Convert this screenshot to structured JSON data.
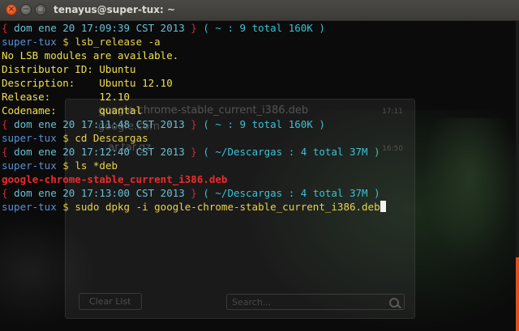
{
  "window": {
    "title": "tenayus@super-tux: ~",
    "close_symbol": "×",
    "minimize_symbol": "−",
    "maximize_symbol": "□"
  },
  "terminal": {
    "host": "super-tux",
    "lines": [
      {
        "type": "status",
        "date": "dom ene 20 17:09:39 CST 2013",
        "dir": "~ : 9 total 160K"
      },
      {
        "type": "prompt",
        "cmd": "lsb_release -a"
      },
      {
        "type": "output",
        "text": "No LSB modules are available."
      },
      {
        "type": "output",
        "text": "Distributor ID: Ubuntu"
      },
      {
        "type": "output",
        "text": "Description:    Ubuntu 12.10"
      },
      {
        "type": "output",
        "text": "Release:        12.10"
      },
      {
        "type": "output",
        "text": "Codename:       quantal"
      },
      {
        "type": "status",
        "date": "dom ene 20 17:11:48 CST 2013",
        "dir": "~ : 9 total 160K"
      },
      {
        "type": "prompt",
        "cmd": "cd Descargas"
      },
      {
        "type": "status",
        "date": "dom ene 20 17:12:40 CST 2013",
        "dir": "~/Descargas : 4 total 37M"
      },
      {
        "type": "prompt",
        "cmd": "ls *deb"
      },
      {
        "type": "file",
        "text": "google-chrome-stable_current_i386.deb"
      },
      {
        "type": "status",
        "date": "dom ene 20 17:13:00 CST 2013",
        "dir": "~/Descargas : 4 total 37M"
      },
      {
        "type": "prompt",
        "cmd": "sudo dpkg -i google-chrome-stable_current_i386.deb"
      }
    ]
  },
  "background_dialog": {
    "rows": [
      "google-chrome-stable_current_i386.deb",
      "google.com",
      "...ar.tar.gz"
    ],
    "times": [
      "17:11",
      "16:50"
    ],
    "clear_button": "Clear List",
    "search_placeholder": "Search..."
  },
  "colors": {
    "close": "#df4b16",
    "titlebar": "#3c3b37",
    "date": "#6abfd6",
    "host": "#5a8fd6",
    "output": "#f0e050",
    "error_file": "#f02a2a"
  }
}
